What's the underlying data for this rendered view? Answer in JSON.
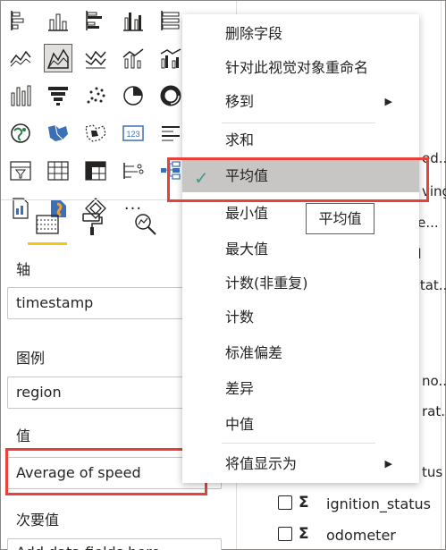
{
  "visualizations": {
    "icons": [
      "stacked-bar-icon",
      "stacked-column-icon",
      "clustered-bar-icon",
      "clustered-column-icon",
      "100-percent-bar-icon",
      "line-chart-icon",
      "area-chart-icon",
      "stacked-area-icon",
      "line-column-icon",
      "line-clustered-column-icon",
      "ribbon-chart-icon",
      "funnel-icon",
      "scatter-icon",
      "pie-chart-icon",
      "donut-chart-icon",
      "map-icon",
      "filled-map-icon",
      "treemap-icon",
      "card-icon",
      "multi-row-card-icon",
      "slicer-icon",
      "table-icon",
      "matrix-icon",
      "kpi-icon",
      "decomposition-tree-icon",
      "paginated-report-icon",
      "python-visual-icon",
      "powerapps-icon",
      "more-visuals-icon"
    ],
    "selected": "area-chart-icon",
    "more_label": "···"
  },
  "tabs": [
    "fields-tab-icon",
    "format-paint-roller-icon",
    "analytics-magnifier-icon"
  ],
  "wells": {
    "axis_label": "轴",
    "axis_value": "timestamp",
    "legend_label": "图例",
    "legend_value": "region",
    "values_label": "值",
    "values_value": "Average of speed",
    "secondary_label": "次要值",
    "secondary_placeholder": "Add data fields here"
  },
  "fields_fragments": {
    "f1": "ed...",
    "f2": "ving",
    "f3": "ete...",
    "f4": "d",
    "f5": "stat...",
    "f6": "no...",
    "f7": "rat...",
    "f8": "tus",
    "ignition": "ignition_status",
    "odometer": "odometer",
    "sigma": "Σ"
  },
  "context_menu": {
    "remove_field": "删除字段",
    "rename": "针对此视觉对象重命名",
    "move_to": "移到",
    "sum": "求和",
    "average": "平均值",
    "minimum": "最小值",
    "maximum": "最大值",
    "count_distinct": "计数(非重复)",
    "count": "计数",
    "std_dev": "标准偏差",
    "variance": "差异",
    "median": "中值",
    "show_value_as": "将值显示为",
    "check_mark": "✓",
    "submenu_arrow": "▶"
  },
  "tooltip": "平均值",
  "colors": {
    "highlight_red": "#e8413a",
    "tab_underline": "#f2c811",
    "check_teal": "#3a9d8f",
    "menu_active": "#c8c6c4"
  }
}
